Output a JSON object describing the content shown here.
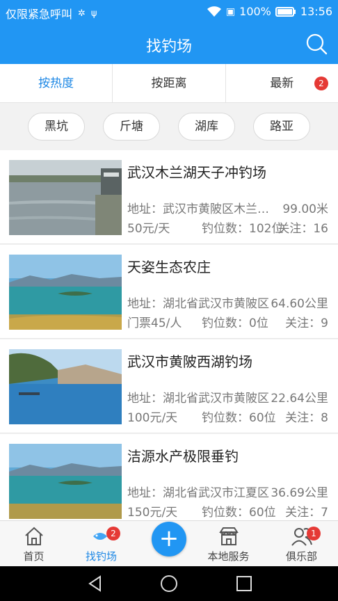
{
  "status": {
    "carrier": "仅限紧急呼叫",
    "battery": "100%",
    "time": "13:56"
  },
  "header": {
    "title": "找钓场",
    "search_icon": "search-icon"
  },
  "sort_tabs": [
    {
      "label": "按热度",
      "active": true
    },
    {
      "label": "按距离",
      "active": false
    },
    {
      "label": "最新",
      "active": false,
      "badge": "2"
    }
  ],
  "categories": [
    "黑坑",
    "斤塘",
    "湖库",
    "路亚"
  ],
  "spots": [
    {
      "name": "武汉木兰湖天子冲钓场",
      "address": "地址：武汉市黄陂区木兰湖天子冲",
      "distance": "99.00米",
      "price": "50元/天",
      "seats": "钓位数：102位",
      "follows": "关注：16"
    },
    {
      "name": "天姿生态农庄",
      "address": "地址：湖北省武汉市黄陂区",
      "distance": "64.60公里",
      "price": "门票45/人",
      "seats": "钓位数：0位",
      "follows": "关注：9"
    },
    {
      "name": "武汉市黄陂西湖钓场",
      "address": "地址：湖北省武汉市黄陂区",
      "distance": "22.64公里",
      "price": "100元/天",
      "seats": "钓位数：60位",
      "follows": "关注：8"
    },
    {
      "name": "洁源水产极限垂钓",
      "address": "地址：湖北省武汉市江夏区",
      "distance": "36.69公里",
      "price": "150元/天",
      "seats": "钓位数：60位",
      "follows": "关注：7"
    }
  ],
  "bottom_nav": {
    "home": "首页",
    "spots": "找钓场",
    "spots_badge": "2",
    "add": "+",
    "local": "本地服务",
    "club": "俱乐部",
    "club_badge": "1"
  },
  "colors": {
    "primary": "#2196f3",
    "badge": "#e53935",
    "active_text": "#1e88e5"
  }
}
